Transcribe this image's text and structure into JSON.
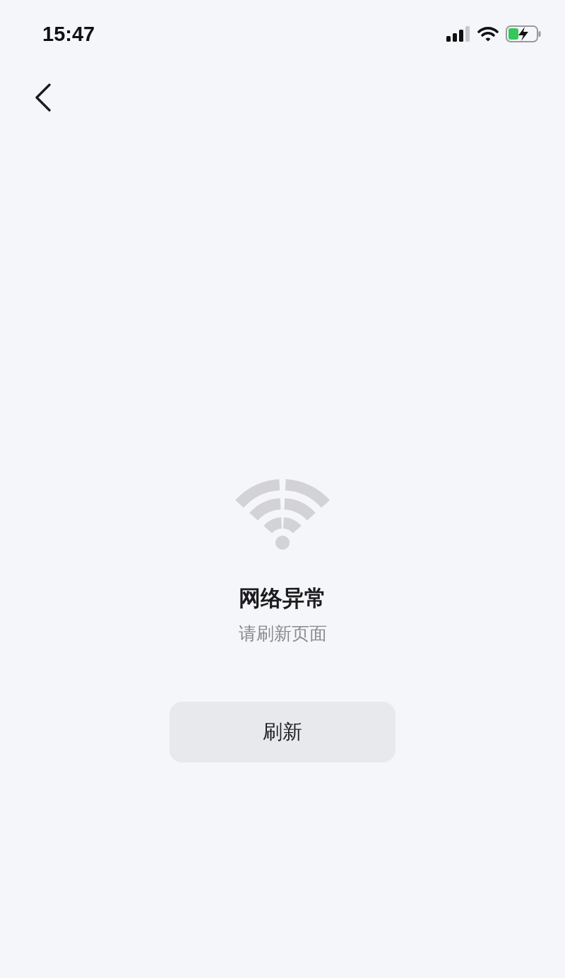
{
  "status_bar": {
    "time": "15:47"
  },
  "empty_state": {
    "title": "网络异常",
    "subtitle": "请刷新页面"
  },
  "buttons": [
    {
      "label": "刷新"
    }
  ]
}
